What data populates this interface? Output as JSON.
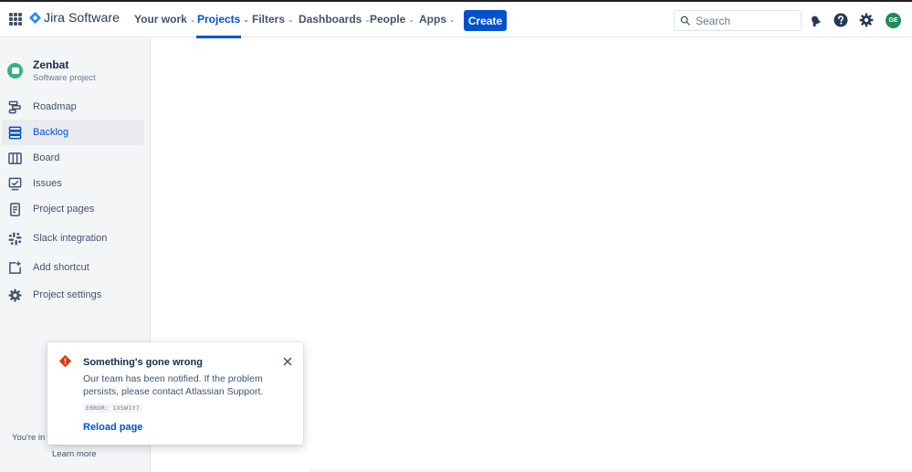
{
  "header": {
    "product_name": "Jira Software",
    "nav": [
      {
        "label": "Your work",
        "chevron": "⌄"
      },
      {
        "label": "Projects",
        "chevron": "⌄"
      },
      {
        "label": "Filters",
        "chevron": "⌄"
      },
      {
        "label": "Dashboards",
        "chevron": "⌄"
      },
      {
        "label": "People",
        "chevron": "⌄"
      },
      {
        "label": "Apps",
        "chevron": "⌄"
      }
    ],
    "active_nav": "Projects",
    "create_label": "Create",
    "search_placeholder": "Search",
    "avatar_initials": "GE",
    "icons": [
      "app-switcher-icon",
      "jira-logo-icon",
      "search-icon",
      "notifications-icon",
      "help-icon",
      "settings-icon"
    ]
  },
  "sidebar": {
    "project_name": "Zenbat",
    "project_type": "Software project",
    "items": [
      {
        "label": "Roadmap",
        "icon": "roadmap-icon"
      },
      {
        "label": "Backlog",
        "icon": "backlog-icon",
        "active": true
      },
      {
        "label": "Board",
        "icon": "board-icon"
      },
      {
        "label": "Issues",
        "icon": "issues-icon"
      },
      {
        "label": "Project pages",
        "icon": "pages-icon"
      },
      {
        "label": "Slack integration",
        "icon": "slack-icon"
      },
      {
        "label": "Add shortcut",
        "icon": "add-shortcut-icon"
      },
      {
        "label": "Project settings",
        "icon": "gear-icon"
      }
    ],
    "footer_text": "You're in a",
    "learn_more": "Learn more"
  },
  "error_flag": {
    "title": "Something's gone wrong",
    "body": "Our team has been notified. If the problem persists, please contact Atlassian Support.",
    "code": "ERROR: 1XSW1Y7",
    "action": "Reload page",
    "icon": "error-icon"
  },
  "colors": {
    "brand_blue": "#0052CC",
    "error_red": "#DE350B",
    "project_green": "#36B37E",
    "avatar_green": "#1f8a5a"
  }
}
